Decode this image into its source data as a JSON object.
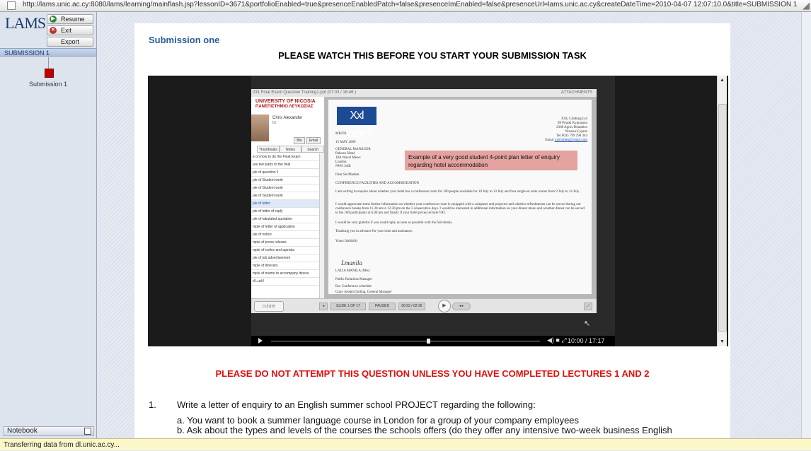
{
  "browser": {
    "url": "http://lams.unic.ac.cy:8080/lams/learning/mainflash.jsp?lessonID=3671&portfolioEnabled=true&presenceEnabledPatch=false&presenceImEnabled=false&presenceUrl=lams.unic.ac.cy&createDateTime=2010-04-07 12:07:10.0&title=SUBMISSION 1"
  },
  "sidebar": {
    "logo": "LAMS",
    "buttons": {
      "resume": "Resume",
      "exit": "Exit",
      "export": "Export"
    },
    "sequence_title": "SUBMISSION 1",
    "activity_label": "Submission 1",
    "notebook": "Notebook"
  },
  "content": {
    "submission_title": "Submission one",
    "headline": "PLEASE WATCH THIS BEFORE YOU START YOUR SUBMISSION TASK",
    "warning": "PLEASE DO NOT ATTEMPT THIS QUESTION UNLESS YOU HAVE COMPLETED LECTURES 1 AND 2",
    "question": {
      "number": "1.",
      "text": "Write a letter of enquiry to an English summer school PROJECT regarding the following:",
      "a": "a.  You want to book a summer language course in London for a group of your company employees",
      "b": "b.  Ask about the types and levels of the courses the schools offers (do they offer any intensive two-week business English"
    }
  },
  "video": {
    "pres_title": "231 Final Exam Question Training1.ppt  (07:03 / 16:46 )",
    "attachments": "ATTACHMENTS",
    "university": "UNIVERSITY OF NICOSIA",
    "university_greek": "ΠΑΝΕΠΙΣΤΗΜΙΟ ΛΕΥΚΩΣΙΑΣ",
    "lecturer": "Chris Alexander",
    "lecturer_role": "Dr",
    "bio": "Bio",
    "email_btn": "Email",
    "tabs": [
      "Thumbnails",
      "Notes",
      "Search"
    ],
    "outline": [
      "e on how to do the Final Exam",
      "are two parts to the final",
      "ple of question 1",
      "ple of Student work",
      "ple of Student work",
      "ple of Student work",
      "ple of letter",
      "ple of letter of reply",
      "ple of tabulated quotation",
      "mple of letter of application",
      "ple of notice",
      "mple of press release",
      "mple of notice and agenda",
      "ple of job advertisement",
      "mple of itinerary",
      "mple of memo to accompany itinera",
      "d Luck!"
    ],
    "selected_outline": 6,
    "slide": {
      "logo": "Xxl clothes",
      "company": "XXL Clothing Ltd",
      "street": "99 Poraki Kyprianou",
      "city": "2368 Agros Dometios",
      "country": "Nicosia-Cyprus",
      "tel": "Tel 0035 799 290 344",
      "email_label": "Email",
      "email": "xxlclothes@ymail.com",
      "ref": "MB/ZB",
      "date": "15 MAY 2009",
      "recipient": [
        "GENERAL MANAGER",
        "Palaces Hotel",
        "10A Wavel Mews",
        "London",
        "NW6 3AB"
      ],
      "callout": "Example of a very good  student  4-point plan letter  of enquiry regarding hotel accommodation",
      "salutation": "Dear Sir/Madam",
      "subject": "CONFERENCE FACILITIES AND ACCOMMODATION",
      "p1": "I am writing to enquire about whether your hotel has a conference room for 100 people available for 10 July to 13 July and four single en suite rooms from 9 July to 14 July.",
      "p2": "I would appreciate some further information on whether your conference room is equipped with a computer and projector and whether refreshments can be served during our conference breaks from 11.30 am to 12.30 pm on the 3 consecutive days. I would be interested in additional information on your dinner menu and whether dinner can be served to the 100 participants at 6.00 pm and finally if your hotel prices include VAT.",
      "p3": "I would be very grateful if you could reply as soon as possible with the full details.",
      "p4": "Thanking you in advance for your time and assistance.",
      "closing": "Yours faithfully",
      "signer": "LAILA MANILA (Mrs)",
      "signer_title": "Public Relations Manager",
      "enc": "Enc      Conference schedule",
      "copy": "Copy    Joseph Darling, General Manager"
    },
    "controls": {
      "brand": "culate",
      "slide_info": "SLIDE 1 OF 17",
      "status": "PAUSED",
      "slide_time": "00:02 / 02:36"
    },
    "player_time": "10:00 / 17:17",
    "progress": 0.58
  },
  "statusbar": {
    "text": "Transferring data from dl.unic.ac.cy..."
  }
}
